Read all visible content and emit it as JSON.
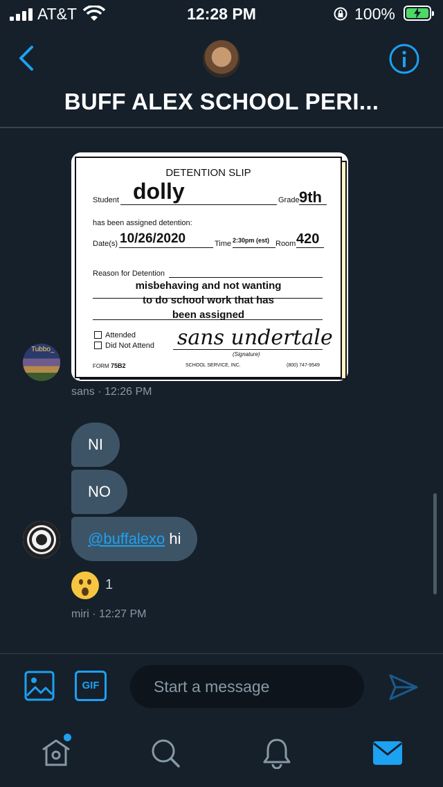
{
  "status_bar": {
    "carrier": "AT&T",
    "time": "12:28 PM",
    "battery": "100%",
    "battery_level": 1.0,
    "battery_color": "#4cd964"
  },
  "header": {
    "back_icon": "chevron-left-icon",
    "title": "BUFF ALEX SCHOOL PERI...",
    "info_icon": "info-icon"
  },
  "messages": [
    {
      "type": "image",
      "sender": "sans",
      "time": "12:26 PM",
      "meta": "sans · 12:26 PM",
      "slip": {
        "heading": "DETENTION SLIP",
        "student_label": "Student",
        "student": "dolly",
        "grade_label": "Grade",
        "grade": "9th",
        "assigned_label": "has been assigned detention:",
        "dates_label": "Date(s)",
        "date": "10/26/2020",
        "time_label": "Time",
        "time": "2:30pm (est)",
        "room_label": "Room",
        "room": "420",
        "reason_label": "Reason for Detention",
        "reason_lines": [
          "misbehaving and not wanting",
          "to do school work that has",
          "been assigned"
        ],
        "attended": "Attended",
        "did_not_attend": "Did Not Attend",
        "signature": "sans undertale",
        "signature_label": "(Signature)",
        "form_label": "FORM",
        "form_number": "75B2",
        "publisher": "SCHOOL SERVICE, INC.",
        "phone": "(800) 747-9549"
      },
      "avatar_text": "Tubbo_"
    },
    {
      "type": "text_group",
      "sender": "miri",
      "meta": "miri · 12:27 PM",
      "bubbles": [
        "NI",
        "NO"
      ],
      "mention": "@buffalexo",
      "mention_tail": " hi",
      "reaction_emoji": "astonished-face",
      "reaction_count": "1"
    }
  ],
  "composer": {
    "image_icon": "image-icon",
    "gif_label": "GIF",
    "placeholder": "Start a message",
    "send_icon": "send-icon"
  },
  "tabs": [
    {
      "name": "home",
      "icon": "home-icon",
      "badge": true
    },
    {
      "name": "search",
      "icon": "search-icon"
    },
    {
      "name": "notifications",
      "icon": "bell-icon"
    },
    {
      "name": "messages",
      "icon": "mail-icon",
      "active": true
    }
  ],
  "colors": {
    "background": "#15202b",
    "accent": "#1da1f2",
    "bubble": "#3d5466",
    "muted": "#8899a6"
  }
}
